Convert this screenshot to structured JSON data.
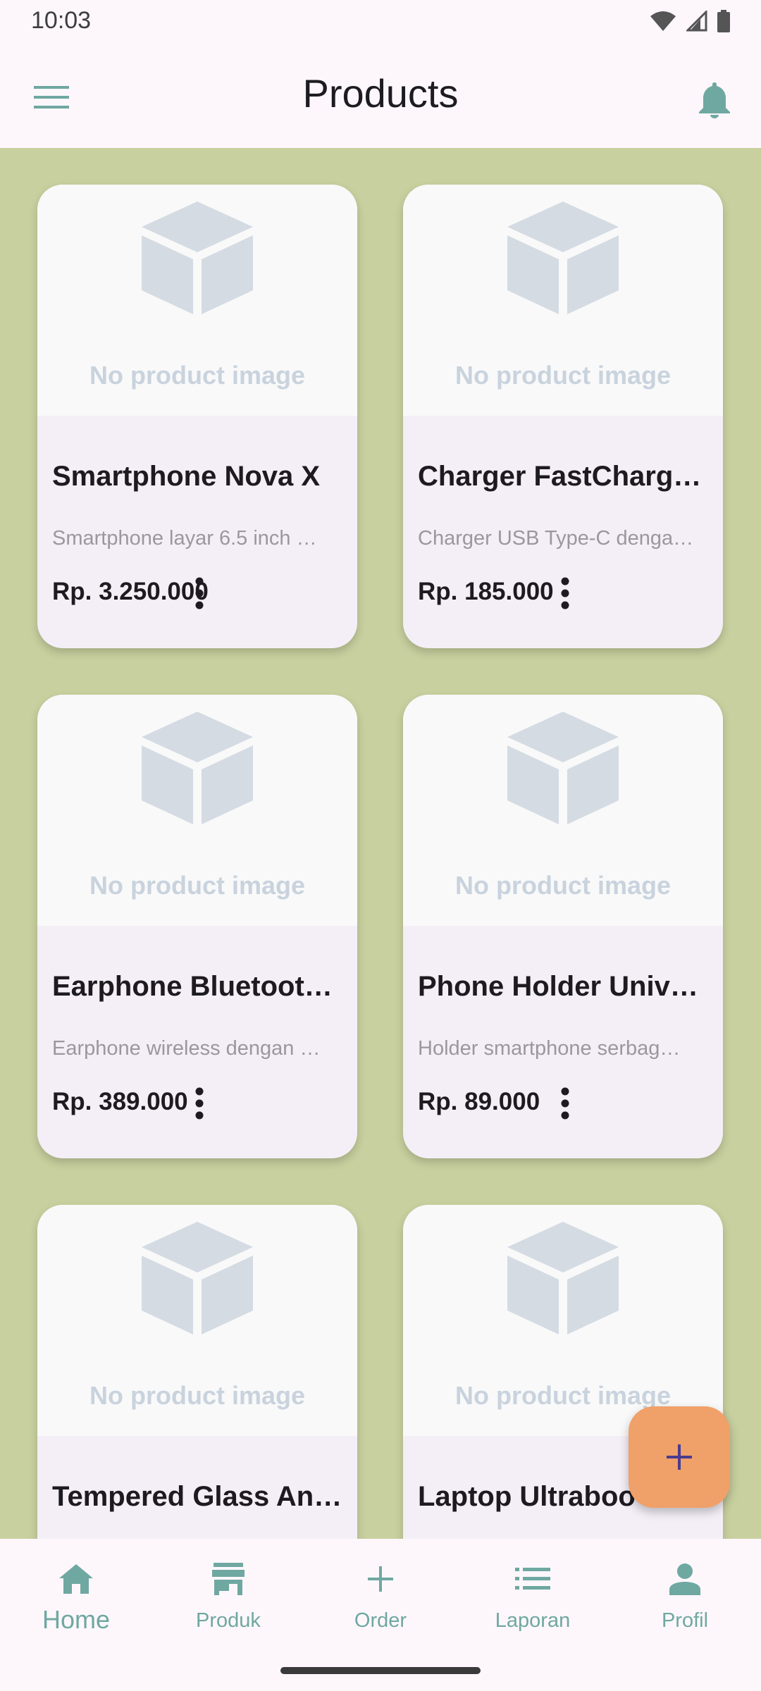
{
  "status_bar": {
    "time": "10:03",
    "icons": [
      "wifi-icon",
      "signal-icon",
      "battery-icon"
    ]
  },
  "app_bar": {
    "title": "Products",
    "left_icon": "menu-icon",
    "right_icon": "bell-icon"
  },
  "colors": {
    "accent": "#6fa8a1",
    "background": "#c8d09f",
    "card": "#f4eff7",
    "fab": "#f0a069",
    "fab_icon": "#4a3b8f",
    "placeholder": "#c9d3de"
  },
  "products": [
    {
      "image_placeholder": "No product image",
      "name": "Smartphone Nova X",
      "description": "Smartphone layar 6.5 inch …",
      "price": "Rp. 3.250.000"
    },
    {
      "image_placeholder": "No product image",
      "name": "Charger FastCharg…",
      "description": "Charger USB Type-C denga…",
      "price": "Rp. 185.000"
    },
    {
      "image_placeholder": "No product image",
      "name": "Earphone Bluetoot…",
      "description": "Earphone wireless dengan …",
      "price": "Rp. 389.000"
    },
    {
      "image_placeholder": "No product image",
      "name": "Phone Holder Univ…",
      "description": "Holder smartphone serbag…",
      "price": "Rp. 89.000"
    },
    {
      "image_placeholder": "No product image",
      "name": "Tempered Glass An…",
      "description": "",
      "price": ""
    },
    {
      "image_placeholder": "No product image",
      "name": "Laptop Ultraboo",
      "description": "",
      "price": ""
    }
  ],
  "fab": {
    "icon": "plus-icon"
  },
  "bottom_nav": {
    "active_index": 0,
    "items": [
      {
        "label": "Home",
        "icon": "home-icon"
      },
      {
        "label": "Produk",
        "icon": "store-icon"
      },
      {
        "label": "Order",
        "icon": "plus-icon"
      },
      {
        "label": "Laporan",
        "icon": "list-icon"
      },
      {
        "label": "Profil",
        "icon": "person-icon"
      }
    ]
  }
}
